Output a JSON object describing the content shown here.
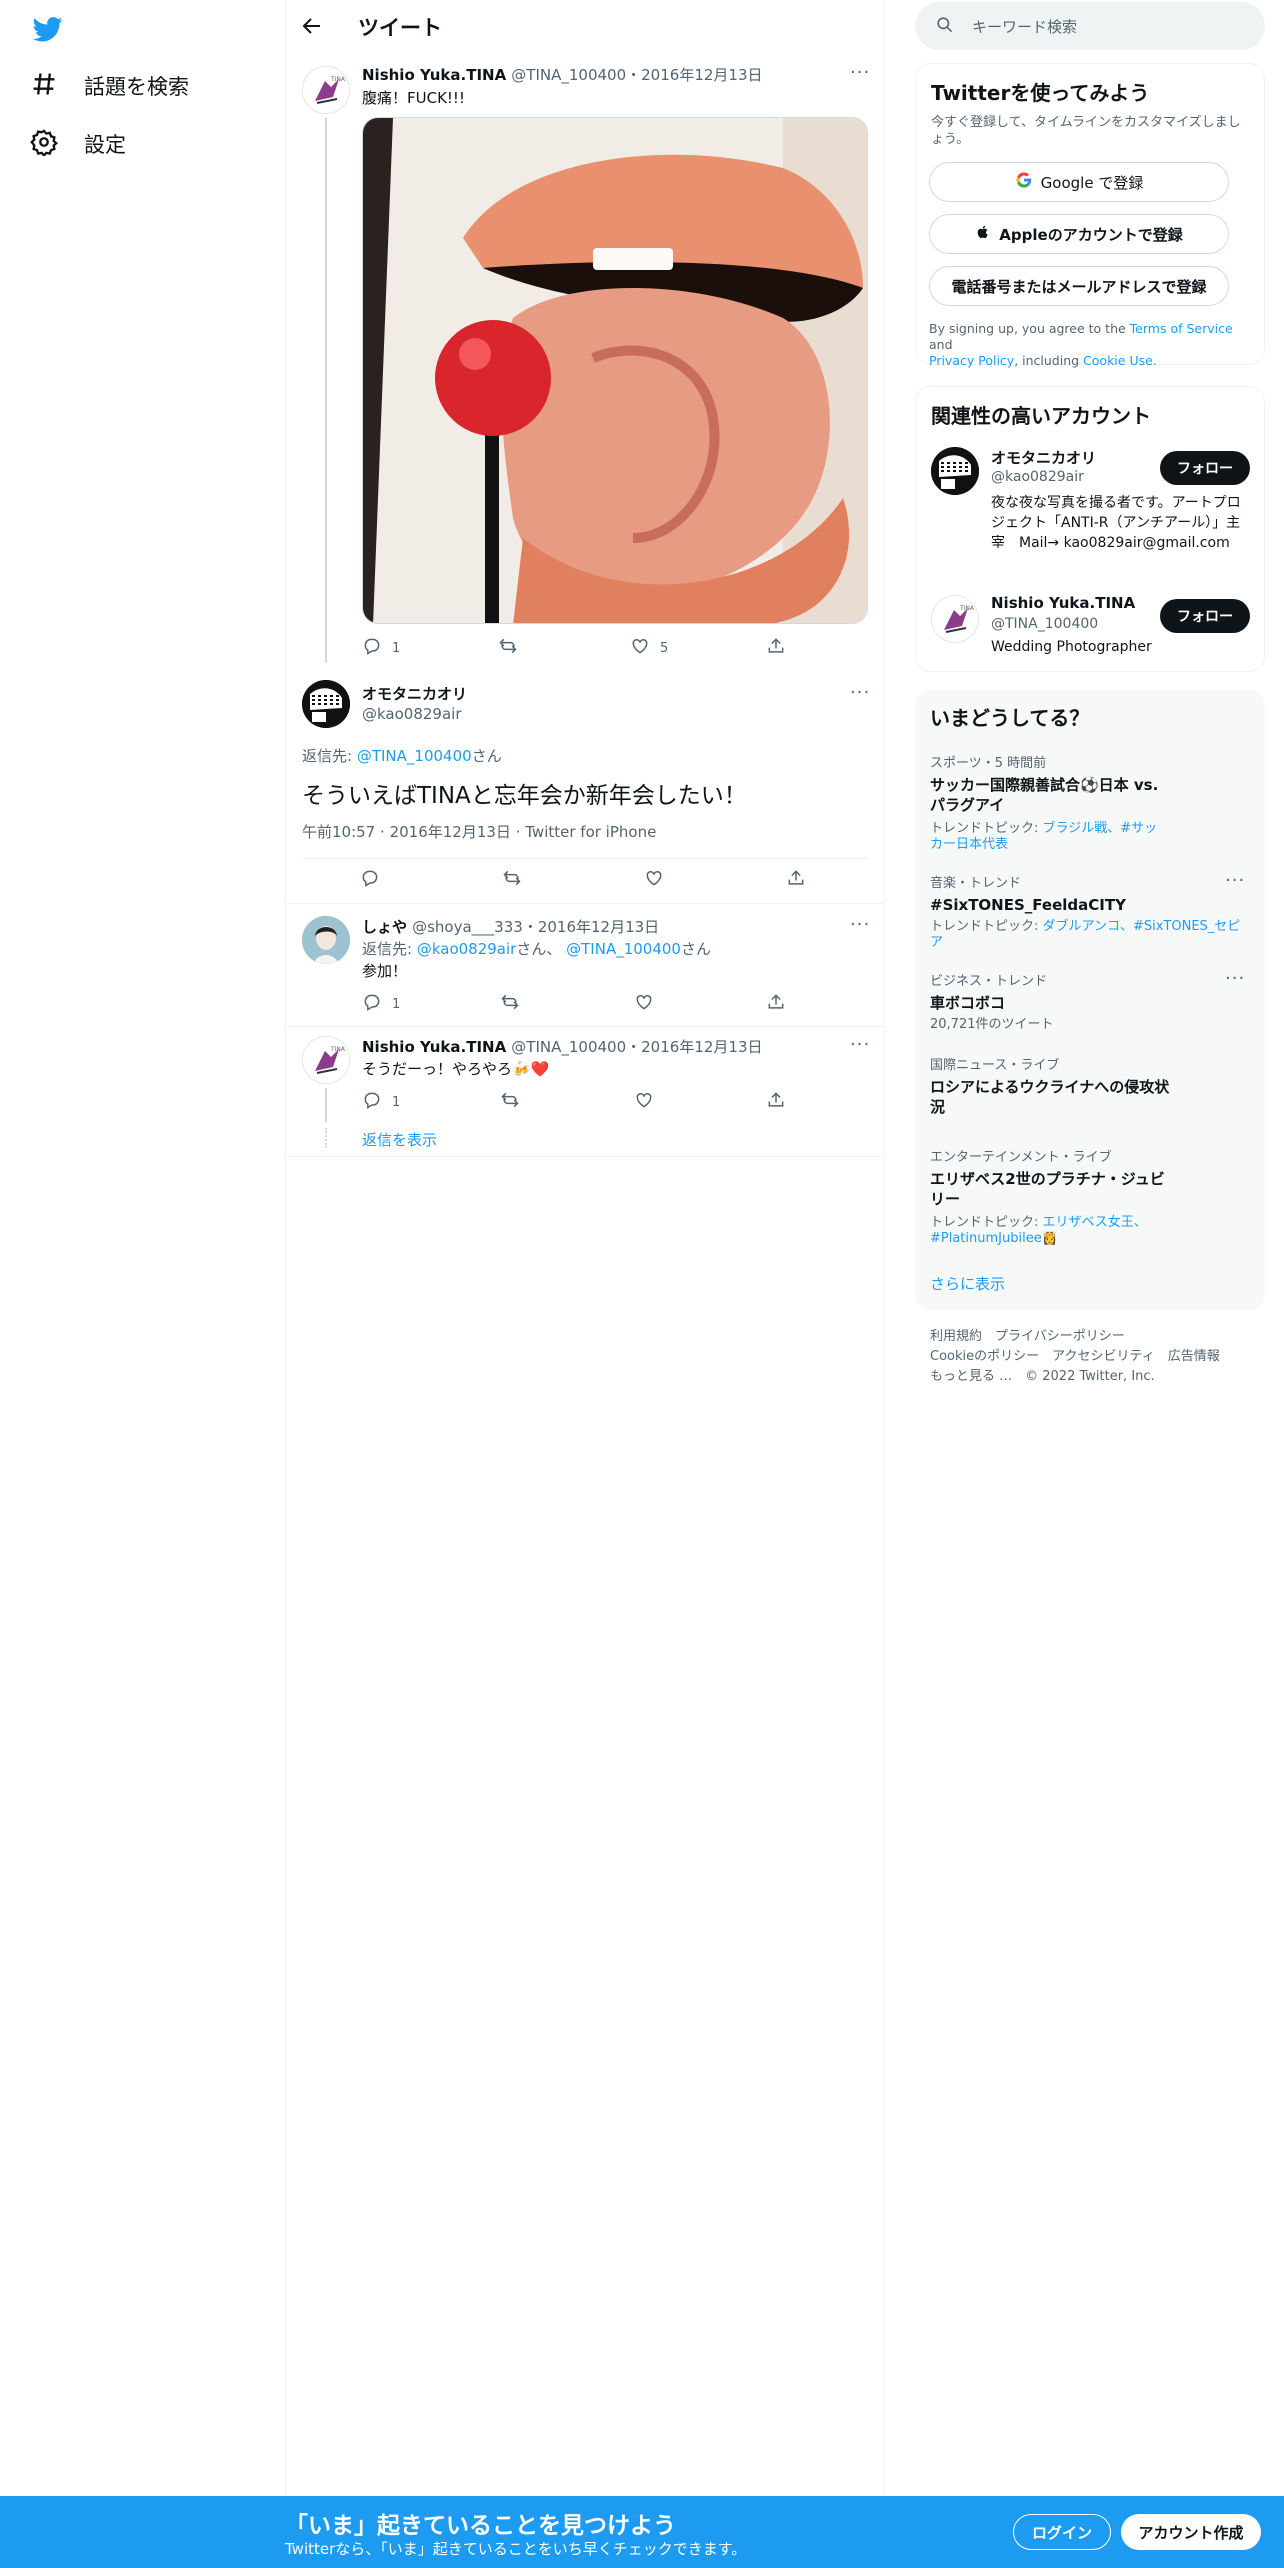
{
  "colors": {
    "brand": "#1d9bf0",
    "text": "#0f1419",
    "muted": "#536471",
    "border": "#eff3f4"
  },
  "nav": {
    "logo_icon": "twitter-bird-icon",
    "items": [
      {
        "label": "話題を検索",
        "icon": "hashtag-icon"
      },
      {
        "label": "設定",
        "icon": "gear-icon"
      }
    ]
  },
  "header": {
    "title": "ツイート"
  },
  "parent_tweet": {
    "name": "Nishio Yuka.TINA",
    "handle": "@TINA_100400",
    "date": "・2016年12月13日",
    "text": "腹痛！FUCK!!!",
    "image_alt": "lips-with-lollipop-photo",
    "replies": "1",
    "retweets": "",
    "likes": "5"
  },
  "main_tweet": {
    "name": "オモタニカオリ",
    "handle": "@kao0829air",
    "reply_prefix": "返信先:",
    "reply_to": "@TINA_100400",
    "reply_suffix": "さん",
    "text": "そういえばTINAと忘年会か新年会したい！",
    "time": "午前10:57",
    "date": "2016年12月13日",
    "source": "Twitter for iPhone"
  },
  "replies": [
    {
      "name": "しょや",
      "handle": "@shoya___333",
      "date": "・2016年12月13日",
      "reply_prefix": "返信先:",
      "reply_to_1": "@kao0829air",
      "reply_mid": "さん、",
      "reply_to_2": "@TINA_100400",
      "reply_suffix": "さん",
      "text": "参加！",
      "replies": "1"
    },
    {
      "name": "Nishio Yuka.TINA",
      "handle": "@TINA_100400",
      "date": "・2016年12月13日",
      "text": "そうだーっ！やろやろ🍻❤️",
      "replies": "1",
      "show_replies": "返信を表示"
    }
  ],
  "search": {
    "placeholder": "キーワード検索"
  },
  "signup_card": {
    "title": "Twitterを使ってみよう",
    "subtitle": "今すぐ登録して、タイムラインをカスタマイズしましょう。",
    "google_label": "Google で登録",
    "apple_label": "Appleのアカウントで登録",
    "phone_label": "電話番号またはメールアドレスで登録",
    "terms_prefix": "By signing up, you agree to the ",
    "terms_link": "Terms of Service",
    "terms_and": " and",
    "privacy_link": "Privacy Policy",
    "terms_including": ", including ",
    "cookie_link": "Cookie Use."
  },
  "related_card": {
    "title": "関連性の高いアカウント",
    "accounts": [
      {
        "name": "オモタニカオリ",
        "handle": "@kao0829air",
        "bio": "夜な夜な写真を撮る者です。アートプロジェクト「ANTI-R（アンチアール）」主宰　Mail→ kao0829air@gmail.com",
        "follow_label": "フォロー"
      },
      {
        "name": "Nishio Yuka.TINA",
        "handle": "@TINA_100400",
        "bio": "Wedding Photographer",
        "follow_label": "フォロー"
      }
    ]
  },
  "trends_card": {
    "title": "いまどうしてる？",
    "trends": [
      {
        "category": "スポーツ・5 時間前",
        "title": "サッカー国際親善試合⚽️日本 vs. パラグアイ",
        "sub_prefix": "トレンドトピック: ",
        "sub_links": "ブラジル戦、#サッカー日本代表"
      },
      {
        "category": "音楽・トレンド",
        "title": "#SixTONES_FeeldaCITY",
        "sub_prefix": "トレンドトピック: ",
        "sub_links": "ダブルアンコ、#SixTONES_セピア"
      },
      {
        "category": "ビジネス・トレンド",
        "title": "車ボコボコ",
        "count": "20,721件のツイート"
      },
      {
        "category": "国際ニュース・ライブ",
        "title": "ロシアによるウクライナへの侵攻状況"
      },
      {
        "category": "エンターテインメント・ライブ",
        "title": "エリザベス2世のプラチナ・ジュビリー",
        "sub_prefix": "トレンドトピック: ",
        "sub_links": "エリザベス女王、#PlatinumJubilee👸"
      }
    ],
    "show_more": "さらに表示"
  },
  "footer": {
    "links_row1": "利用規約　プライバシーポリシー",
    "links_row2": "Cookieのポリシー　アクセシビリティ　広告情報",
    "links_row3": "もっと見る …　© 2022 Twitter, Inc."
  },
  "bottom_bar": {
    "title": "「いま」起きていることを見つけよう",
    "subtitle": "Twitterなら、「いま」起きていることをいち早くチェックできます。",
    "login_label": "ログイン",
    "signup_label": "アカウント作成"
  }
}
